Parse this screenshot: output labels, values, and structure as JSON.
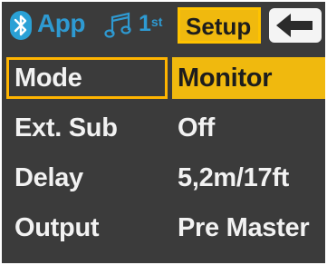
{
  "topbar": {
    "bluetooth_icon": "bluetooth-icon",
    "app_label": "App",
    "music_icon": "music-note-icon",
    "first_label": "1",
    "first_suffix": "st",
    "tab_setup_label": "Setup",
    "back_icon": "back-arrow-icon"
  },
  "rows": [
    {
      "label": "Mode",
      "value": "Monitor",
      "selected": true
    },
    {
      "label": "Ext. Sub",
      "value": "Off",
      "selected": false
    },
    {
      "label": "Delay",
      "value": "5,2m/17ft",
      "selected": false
    },
    {
      "label": "Output",
      "value": "Pre Master",
      "selected": false
    }
  ],
  "colors": {
    "background": "#3b3b3b",
    "accent": "#f0b90e",
    "blue": "#2e9ad2",
    "text": "#f2f2f2"
  }
}
